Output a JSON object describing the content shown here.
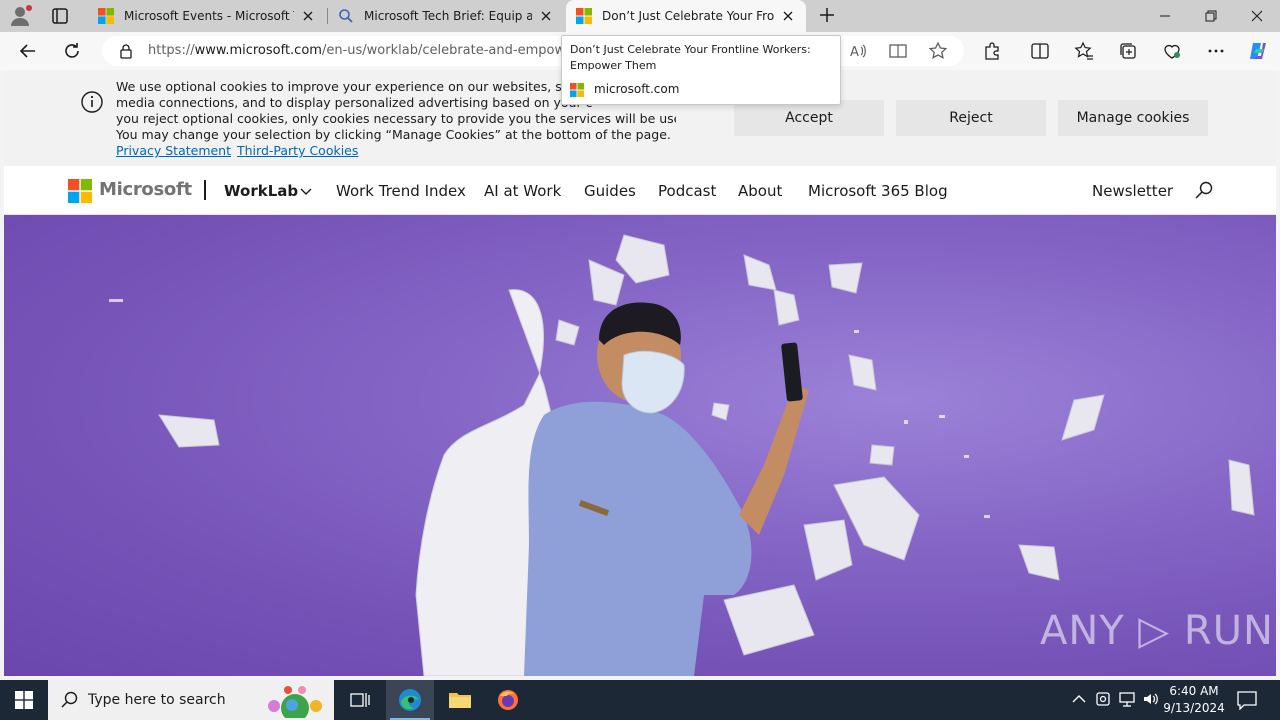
{
  "browser": {
    "tabs": [
      {
        "title": "Microsoft Events - Microsoft Tech",
        "favicon": "microsoft-logo-icon",
        "active": false
      },
      {
        "title": "Microsoft Tech Brief: Equip and E",
        "favicon": "search-icon",
        "active": false
      },
      {
        "title": "Don’t Just Celebrate Your Frontlin",
        "favicon": "microsoft-logo-icon",
        "active": true
      }
    ],
    "url_prefix": "https://",
    "url_host": "www.microsoft.com",
    "url_path": "/en-us/worklab/celebrate-and-empower-",
    "tooltip": {
      "title": "Don’t Just Celebrate Your Frontline Workers: Empower Them",
      "domain": "microsoft.com"
    }
  },
  "cookie_banner": {
    "lines": [
      "We use optional cookies to improve your experience on our websites, such a",
      "media connections, and to display personalized advertising based on your c",
      "you reject optional cookies, only cookies necessary to provide you the services will be used.",
      "You may change your selection by clicking “Manage Cookies” at the bottom of the page."
    ],
    "privacy_link": "Privacy Statement",
    "third_party_link": "Third-Party Cookies",
    "accept": "Accept",
    "reject": "Reject",
    "manage": "Manage cookies"
  },
  "site_nav": {
    "logo_text": "Microsoft",
    "brand": "WorkLab",
    "items": [
      "Work Trend Index",
      "AI at Work",
      "Guides",
      "Podcast",
      "About",
      "Microsoft 365 Blog"
    ],
    "newsletter": "Newsletter"
  },
  "hero": {
    "watermark": "ANY ▷ RUN"
  },
  "taskbar": {
    "search_placeholder": "Type here to search",
    "time": "6:40 AM",
    "date": "9/13/2024"
  },
  "colors": {
    "ms_red": "#f25022",
    "ms_green": "#7fba00",
    "ms_blue": "#00a4ef",
    "ms_yellow": "#ffb900",
    "link": "#0067b8",
    "hero_purple": "#7b5cc0"
  }
}
